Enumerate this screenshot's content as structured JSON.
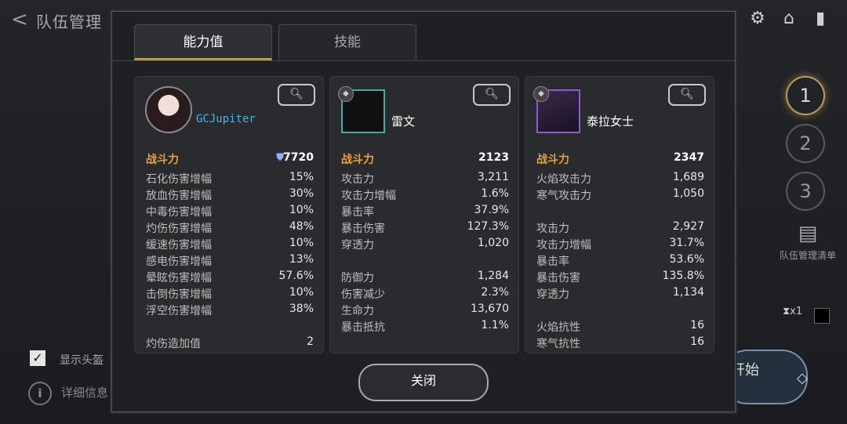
{
  "header": {
    "back": "<",
    "title": "队伍管理"
  },
  "side": {
    "team_slots": [
      "1",
      "2",
      "3"
    ],
    "list_label": "队伍管理清单",
    "hourglass": "x1"
  },
  "bottom_left": {
    "show_helmet": "显示头盔",
    "details": "详细信息",
    "checkbox_mark": "✓"
  },
  "start": {
    "label": "开始"
  },
  "modal": {
    "tabs": [
      "能力值",
      "技能"
    ],
    "close_label": "关闭",
    "panels": [
      {
        "name": "GCJupiter",
        "power_label": "战斗力",
        "power_value": "7720",
        "rows": [
          [
            "石化伤害增幅",
            "15%"
          ],
          [
            "放血伤害增幅",
            "30%"
          ],
          [
            "中毒伤害增幅",
            "10%"
          ],
          [
            "灼伤伤害增幅",
            "48%"
          ],
          [
            "缓速伤害增幅",
            "10%"
          ],
          [
            "感电伤害增幅",
            "13%"
          ],
          [
            "晕眩伤害增幅",
            "57.6%"
          ],
          [
            "击倒伤害增幅",
            "10%"
          ],
          [
            "浮空伤害增幅",
            "38%"
          ],
          [
            "",
            ""
          ],
          [
            "灼伤造加值",
            "2"
          ]
        ]
      },
      {
        "name": "雷文",
        "power_label": "战斗力",
        "power_value": "2123",
        "rows": [
          [
            "攻击力",
            "3,211"
          ],
          [
            "攻击力增幅",
            "1.6%"
          ],
          [
            "暴击率",
            "37.9%"
          ],
          [
            "暴击伤害",
            "127.3%"
          ],
          [
            "穿透力",
            "1,020"
          ],
          [
            "",
            ""
          ],
          [
            "防御力",
            "1,284"
          ],
          [
            "伤害减少",
            "2.3%"
          ],
          [
            "生命力",
            "13,670"
          ],
          [
            "暴击抵抗",
            "1.1%"
          ]
        ]
      },
      {
        "name": "泰拉女士",
        "power_label": "战斗力",
        "power_value": "2347",
        "rows": [
          [
            "火焰攻击力",
            "1,689"
          ],
          [
            "寒气攻击力",
            "1,050"
          ],
          [
            "",
            ""
          ],
          [
            "攻击力",
            "2,927"
          ],
          [
            "攻击力增幅",
            "31.7%"
          ],
          [
            "暴击率",
            "53.6%"
          ],
          [
            "暴击伤害",
            "135.8%"
          ],
          [
            "穿透力",
            "1,134"
          ],
          [
            "",
            ""
          ],
          [
            "火焰抗性",
            "16"
          ],
          [
            "寒气抗性",
            "16"
          ]
        ]
      }
    ]
  }
}
